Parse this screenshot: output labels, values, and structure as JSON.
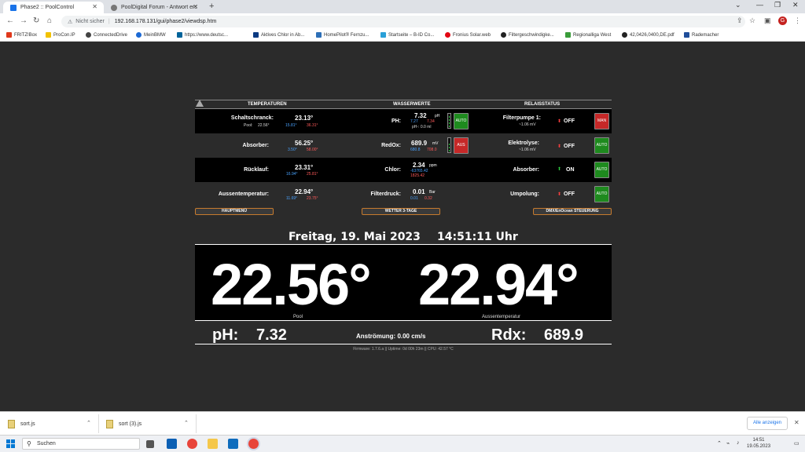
{
  "browser": {
    "tabs": [
      {
        "title": "Phase2 :: PoolControl",
        "active": true
      },
      {
        "title": "PoolDigital Forum - Antwort ers",
        "active": false
      }
    ],
    "address": {
      "security": "Nicht sicher",
      "url": "192.168.178.131/gui/phase2/viewdsp.htm"
    },
    "profile_initial": "G",
    "bookmarks": [
      "FRITZ!Box",
      "ProCon.IP",
      "ConnectedDrive",
      "MeinBMW",
      "https://www.deutsc...",
      "Aktives Chlor in Ab...",
      "HomePilot® Fernzu...",
      "Startseite – B-ID Co...",
      "Fronius Solar.web",
      "Filtergeschwindigke...",
      "Regionalliga West",
      "42,0426,0400,DE.pdf",
      "Rademacher"
    ]
  },
  "page": {
    "headers": {
      "temperatures": "TEMPERATUREN",
      "water": "WASSERWERTE",
      "relays": "RELAISSTATUS"
    },
    "rows": [
      {
        "temp": {
          "label": "Schaltschranck:",
          "value": "23.13°",
          "sub_label": "Pool:",
          "sub_value": "22.56°",
          "min": "15.81°",
          "max": "36.31°"
        },
        "water": {
          "label": "PH:",
          "value": "7.32",
          "unit": "pH",
          "min": "7.27",
          "max": "7.34",
          "extra": "pH-: 0.0 ml",
          "button": "AUTO"
        },
        "relay": {
          "label": "Filterpumpe 1:",
          "sub": "~1.06 mV",
          "status": "OFF",
          "button": "MAN"
        }
      },
      {
        "temp": {
          "label": "Absorber:",
          "value": "56.25°",
          "min": "3.50°",
          "max": "58.00°"
        },
        "water": {
          "label": "RedOx:",
          "value": "689.9",
          "unit": "mV",
          "min": "680.8",
          "max": "708.0",
          "button": "AUS"
        },
        "relay": {
          "label": "Elektrolyse:",
          "sub": "~1.06 mV",
          "status": "OFF",
          "button": "AUTO"
        }
      },
      {
        "temp": {
          "label": "Rücklauf:",
          "value": "23.31°",
          "min": "16.94°",
          "max": "25.81°"
        },
        "water": {
          "label": "Chlor:",
          "value": "2.34",
          "unit": "ppm",
          "min": "-63765.42",
          "max": "1825.42"
        },
        "relay": {
          "label": "Absorber:",
          "status": "ON",
          "button": "AUTO"
        }
      },
      {
        "temp": {
          "label": "Aussentemperatur:",
          "value": "22.94°",
          "min": "11.69°",
          "max": "23.75°"
        },
        "water": {
          "label": "Filterdruck:",
          "value": "0.01",
          "unit": "Bar",
          "min": "0.01",
          "max": "0.32"
        },
        "relay": {
          "label": "Umpolung:",
          "status": "OFF",
          "button": "AUTO"
        }
      }
    ],
    "nav_buttons": [
      "HAUPTMENÜ",
      "WETTER 3-TAGE",
      "DMX/EnOcean STEUERUNG"
    ],
    "date": "Freitag, 19. Mai 2023",
    "time": "14:51:11 Uhr",
    "big": {
      "left_value": "22.56°",
      "left_label": "Pool",
      "right_value": "22.94°",
      "right_label": "Aussentemperatur"
    },
    "bottom": {
      "ph_label": "pH:",
      "ph_value": "7.32",
      "flow": "Anströmung: 0.00 cm/s",
      "rdx_label": "Rdx:",
      "rdx_value": "689.9"
    },
    "firmware": "Firmware: 1.7.6.a   ||   Uptime: 0d 00h 23m   ||   CPU: 42.57 °C"
  },
  "downloads": {
    "items": [
      "sort.js",
      "sort (3).js"
    ],
    "show_all": "Alle anzeigen"
  },
  "taskbar": {
    "search_placeholder": "Suchen",
    "time": "14:51",
    "date": "19.05.2023"
  },
  "colors": {
    "page_bg": "#2b2b2b",
    "green_button": "#1e8a1e",
    "red_button": "#c62828",
    "nav_border": "#c77b2e",
    "on_green": "#2ecc40",
    "off_red": "#ff4040"
  }
}
